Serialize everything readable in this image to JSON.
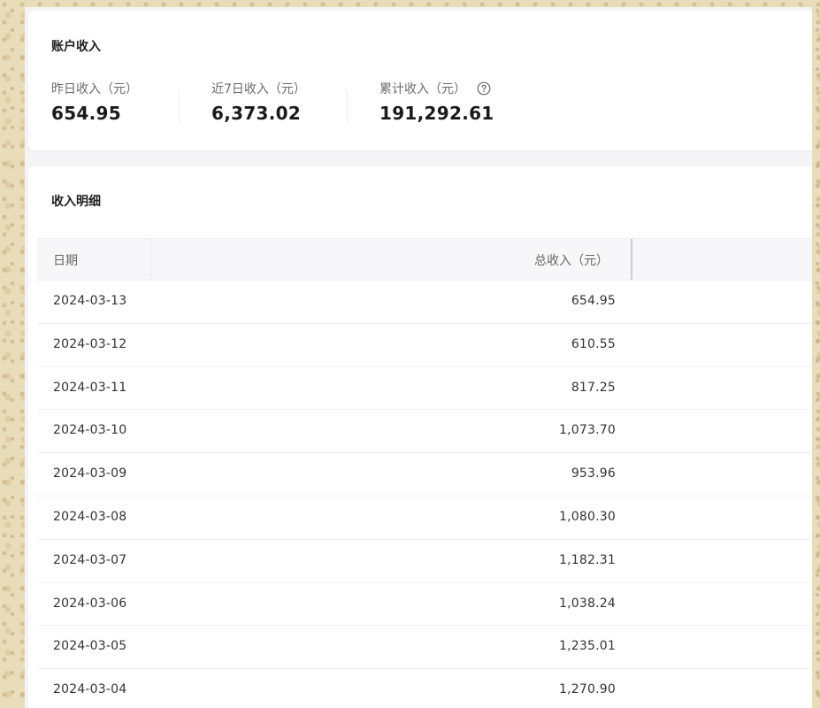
{
  "account": {
    "title": "账户收入",
    "stats": [
      {
        "label": "昨日收入（元）",
        "value": "654.95",
        "has_help": false
      },
      {
        "label": "近7日收入（元）",
        "value": "6,373.02",
        "has_help": false
      },
      {
        "label": "累计收入（元）",
        "value": "191,292.61",
        "has_help": true
      }
    ]
  },
  "detail": {
    "title": "收入明细",
    "columns": {
      "date": "日期",
      "income": "总收入（元）"
    },
    "rows": [
      {
        "date": "2024-03-13",
        "income": "654.95"
      },
      {
        "date": "2024-03-12",
        "income": "610.55"
      },
      {
        "date": "2024-03-11",
        "income": "817.25"
      },
      {
        "date": "2024-03-10",
        "income": "1,073.70"
      },
      {
        "date": "2024-03-09",
        "income": "953.96"
      },
      {
        "date": "2024-03-08",
        "income": "1,080.30"
      },
      {
        "date": "2024-03-07",
        "income": "1,182.31"
      },
      {
        "date": "2024-03-06",
        "income": "1,038.24"
      },
      {
        "date": "2024-03-05",
        "income": "1,235.01"
      },
      {
        "date": "2024-03-04",
        "income": "1,270.90"
      }
    ]
  },
  "icons": {
    "help": "question-circle-icon"
  },
  "colors": {
    "card": "#ffffff",
    "page": "#f4f4f6",
    "header_bg": "#f7f7f9",
    "text": "#333333",
    "muted": "#6b6b6b"
  }
}
